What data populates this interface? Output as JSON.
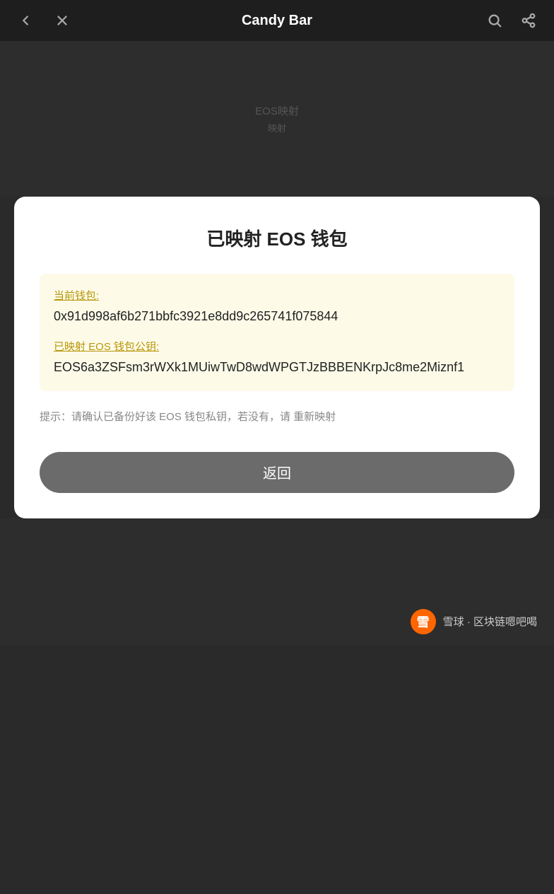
{
  "header": {
    "title": "Candy Bar",
    "back_label": "←",
    "close_label": "×"
  },
  "modal": {
    "title": "已映射 EOS 钱包",
    "info_box": {
      "wallet_label": "当前钱包:",
      "wallet_value": "0x91d998af6b271bbfc3921e8dd9c265741f075844",
      "eos_label": "已映射 EOS 钱包公钥:",
      "eos_value": "EOS6a3ZSFsm3rWXk1MUiwTwD8wdWPGTJzBBBENKrpJc8me2Miznf1"
    },
    "hint": "提示：请确认已备份好该 EOS 钱包私钥，若没有，请 重新映射",
    "return_button": "返回"
  },
  "footer": {
    "brand_logo": "雪",
    "brand_text": "雪球 · 区块链嗯吧喝"
  }
}
